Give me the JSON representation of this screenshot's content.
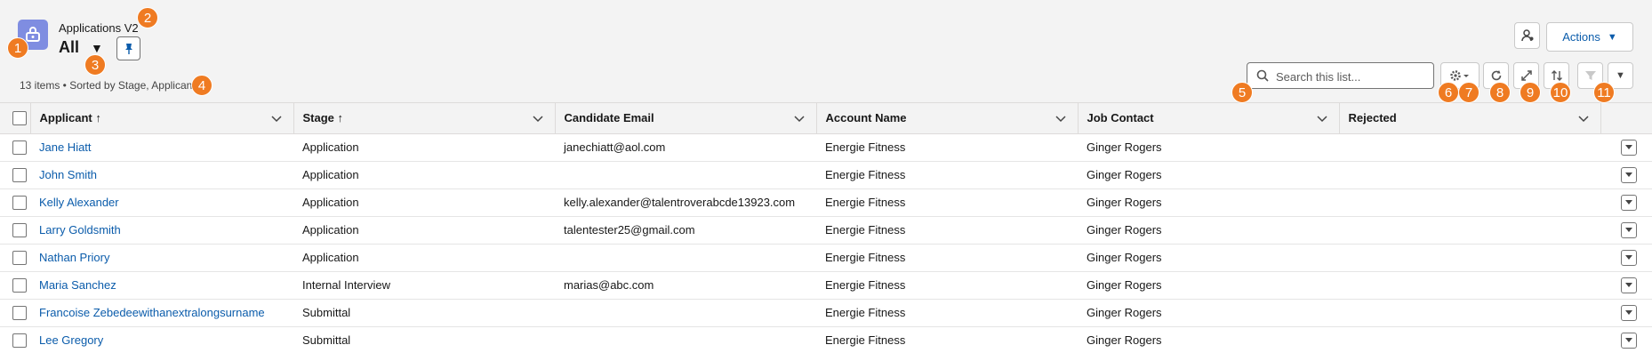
{
  "header": {
    "object_label": "Applications V2",
    "view_name": "All",
    "meta": "13 items • Sorted by Stage, Applicant",
    "actions_label": "Actions",
    "search_placeholder": "Search this list..."
  },
  "icons": {
    "object": "object-icon",
    "pin": "pin-icon",
    "assign": "assign-user-icon",
    "search": "search-icon",
    "settings": "gear-icon",
    "refresh": "refresh-icon",
    "expand": "expand-icon",
    "sort": "sort-icon",
    "filter": "filter-icon"
  },
  "badges": [
    "1",
    "2",
    "3",
    "4",
    "5",
    "6",
    "7",
    "8",
    "9",
    "10",
    "11"
  ],
  "table": {
    "columns": [
      "Applicant ↑",
      "Stage ↑",
      "Candidate Email",
      "Account Name",
      "Job Contact",
      "Rejected"
    ],
    "rows": [
      {
        "applicant": "Jane Hiatt",
        "stage": "Application",
        "email": "janechiatt@aol.com",
        "account": "Energie Fitness",
        "contact": "Ginger Rogers",
        "rejected": ""
      },
      {
        "applicant": "John Smith",
        "stage": "Application",
        "email": "",
        "account": "Energie Fitness",
        "contact": "Ginger Rogers",
        "rejected": ""
      },
      {
        "applicant": "Kelly Alexander",
        "stage": "Application",
        "email": "kelly.alexander@talentroverabcde13923.com",
        "account": "Energie Fitness",
        "contact": "Ginger Rogers",
        "rejected": ""
      },
      {
        "applicant": "Larry Goldsmith",
        "stage": "Application",
        "email": "talentester25@gmail.com",
        "account": "Energie Fitness",
        "contact": "Ginger Rogers",
        "rejected": ""
      },
      {
        "applicant": "Nathan Priory",
        "stage": "Application",
        "email": "",
        "account": "Energie Fitness",
        "contact": "Ginger Rogers",
        "rejected": ""
      },
      {
        "applicant": "Maria Sanchez",
        "stage": "Internal Interview",
        "email": "marias@abc.com",
        "account": "Energie Fitness",
        "contact": "Ginger Rogers",
        "rejected": ""
      },
      {
        "applicant": "Francoise Zebedeewithanextralongsurname",
        "stage": "Submittal",
        "email": "",
        "account": "Energie Fitness",
        "contact": "Ginger Rogers",
        "rejected": ""
      },
      {
        "applicant": "Lee Gregory",
        "stage": "Submittal",
        "email": "",
        "account": "Energie Fitness",
        "contact": "Ginger Rogers",
        "rejected": ""
      }
    ]
  },
  "colors": {
    "accent": "#0b5cab",
    "badge": "#ef7b22",
    "object_icon": "#7f8de1"
  }
}
